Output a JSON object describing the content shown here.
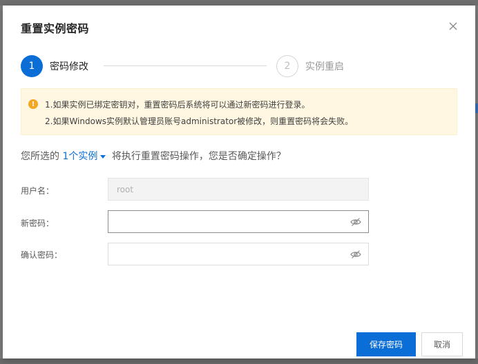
{
  "dialog": {
    "title": "重置实例密码"
  },
  "steps": [
    {
      "number": "1",
      "label": "密码修改",
      "state": "active"
    },
    {
      "number": "2",
      "label": "实例重启",
      "state": "inactive"
    }
  ],
  "notice": {
    "icon": "warning-icon",
    "lines": [
      "1.如果实例已绑定密钥对，重置密码后系统将可以通过新密码进行登录。",
      "2.如果Windows实例默认管理员账号administrator被修改，则重置密码将会失败。"
    ]
  },
  "confirm": {
    "prefix": "您所选的 ",
    "link": "1个实例",
    "suffix": " 将执行重置密码操作，您是否确定操作？"
  },
  "form": {
    "username_label": "用户名：",
    "username_value": "root",
    "new_password_label": "新密码：",
    "new_password_value": "",
    "confirm_password_label": "确认密码：",
    "confirm_password_value": ""
  },
  "buttons": {
    "save": "保存密码",
    "cancel": "取消"
  },
  "colors": {
    "primary": "#0b6dd6",
    "notice_bg": "#fff7e1",
    "notice_icon": "#f5a623"
  }
}
